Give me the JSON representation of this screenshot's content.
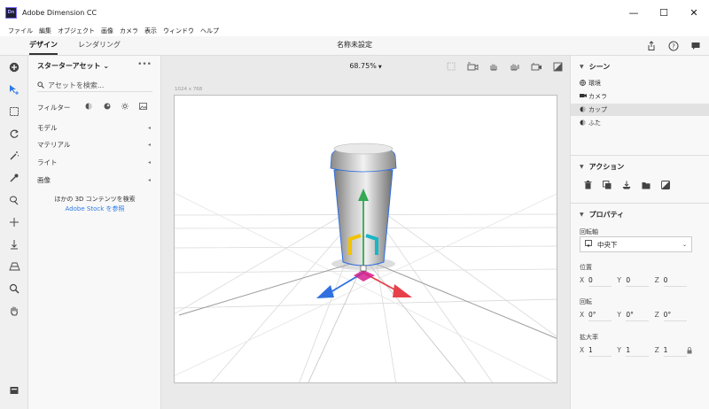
{
  "window": {
    "app_badge": "Dn",
    "title": "Adobe Dimension CC",
    "minimize": "—",
    "maximize": "☐",
    "close": "✕"
  },
  "menu": [
    "ファイル",
    "編集",
    "オブジェクト",
    "画像",
    "カメラ",
    "表示",
    "ウィンドウ",
    "ヘルプ"
  ],
  "tabs": {
    "design": "デザイン",
    "render": "レンダリング",
    "document_title": "名称未設定"
  },
  "left_panel": {
    "title": "スターターアセット",
    "search_placeholder": "アセットを検索...",
    "filter_label": "フィルター",
    "sections": [
      "モデル",
      "マテリアル",
      "ライト",
      "画像"
    ],
    "stock_line1": "ほかの 3D コンテンツを検索",
    "stock_link": "Adobe Stock を参照"
  },
  "canvas": {
    "zoom": "68.75%",
    "size_label": "1024 x 768"
  },
  "right_panel": {
    "scene_title": "シーン",
    "scene_items": [
      {
        "label": "環境",
        "icon": "environment-icon",
        "selected": false
      },
      {
        "label": "カメラ",
        "icon": "camera-icon",
        "selected": false
      },
      {
        "label": "カップ",
        "icon": "model-icon",
        "selected": true
      },
      {
        "label": "ふた",
        "icon": "model-icon",
        "selected": false
      }
    ],
    "actions_title": "アクション",
    "properties_title": "プロパティ",
    "pivot_label": "回転軸",
    "pivot_value": "中央下",
    "position_label": "位置",
    "position": {
      "x": "0",
      "y": "0",
      "z": "0"
    },
    "rotation_label": "回転",
    "rotation": {
      "x": "0°",
      "y": "0°",
      "z": "0°"
    },
    "scale_label": "拡大率",
    "scale": {
      "x": "1",
      "y": "1",
      "z": "1"
    },
    "axis_x": "X",
    "axis_y": "Y",
    "axis_z": "Z"
  },
  "colors": {
    "accent": "#2d7be5",
    "gizmo_x": "#e8404a",
    "gizmo_y": "#35a853",
    "gizmo_z": "#2f6fe0",
    "gizmo_yellow": "#f2c200",
    "gizmo_cyan": "#19b6c4",
    "gizmo_magenta": "#d4208f"
  }
}
